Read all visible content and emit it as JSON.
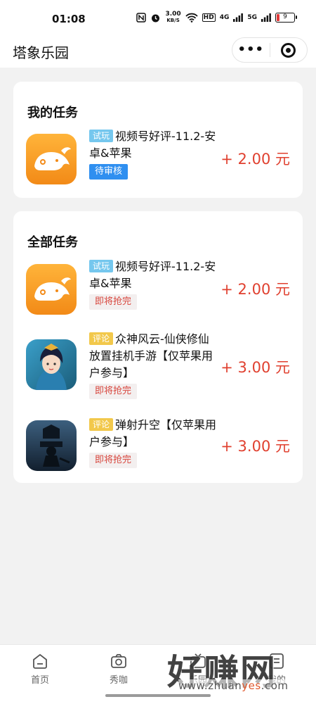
{
  "status_bar": {
    "time": "01:08",
    "speed_value": "3.00",
    "speed_unit": "KB/S",
    "hd": "HD",
    "net1": "4G",
    "net2": "5G",
    "battery": "9"
  },
  "app_bar": {
    "title": "塔象乐园",
    "more_label": "•••"
  },
  "my_tasks": {
    "title": "我的任务",
    "items": [
      {
        "tag": "试玩",
        "tag_type": "play",
        "name": "视频号好评-11.2-安卓&苹果",
        "status": "待审核",
        "status_type": "pending",
        "price": "+ 2.00 元",
        "icon": "elephant-game-icon"
      }
    ]
  },
  "all_tasks": {
    "title": "全部任务",
    "items": [
      {
        "tag": "试玩",
        "tag_type": "play",
        "name": "视频号好评-11.2-安卓&苹果",
        "status": "即将抢完",
        "status_type": "soon",
        "price": "+ 2.00 元",
        "icon": "elephant-game-icon"
      },
      {
        "tag": "评论",
        "tag_type": "review",
        "name": "众神风云-仙侠修仙放置挂机手游【仅苹果用户参与】",
        "status": "即将抢完",
        "status_type": "soon",
        "price": "+ 3.00 元",
        "icon": "fairy-character-icon"
      },
      {
        "tag": "评论",
        "tag_type": "review",
        "name": "弹射升空【仅苹果用户参与】",
        "status": "即将抢完",
        "status_type": "soon",
        "price": "+ 3.00 元",
        "icon": "silhouette-game-icon"
      }
    ]
  },
  "tab_bar": {
    "items": [
      {
        "label": "首页",
        "icon": "home-icon"
      },
      {
        "label": "秀咖",
        "icon": "camera-icon"
      },
      {
        "label": "乐园",
        "icon": "tv-icon"
      },
      {
        "label": "我的",
        "icon": "profile-icon"
      }
    ]
  },
  "watermark": {
    "big": "好赚网",
    "url_pre": "www.zhuan",
    "url_hl": "yes",
    "url_post": ".com"
  },
  "colors": {
    "price": "#e0402f",
    "tag_play": "#75c7ee",
    "tag_review": "#f2c84b",
    "status_pending": "#2f8ff0",
    "status_soon_text": "#d8463d"
  }
}
